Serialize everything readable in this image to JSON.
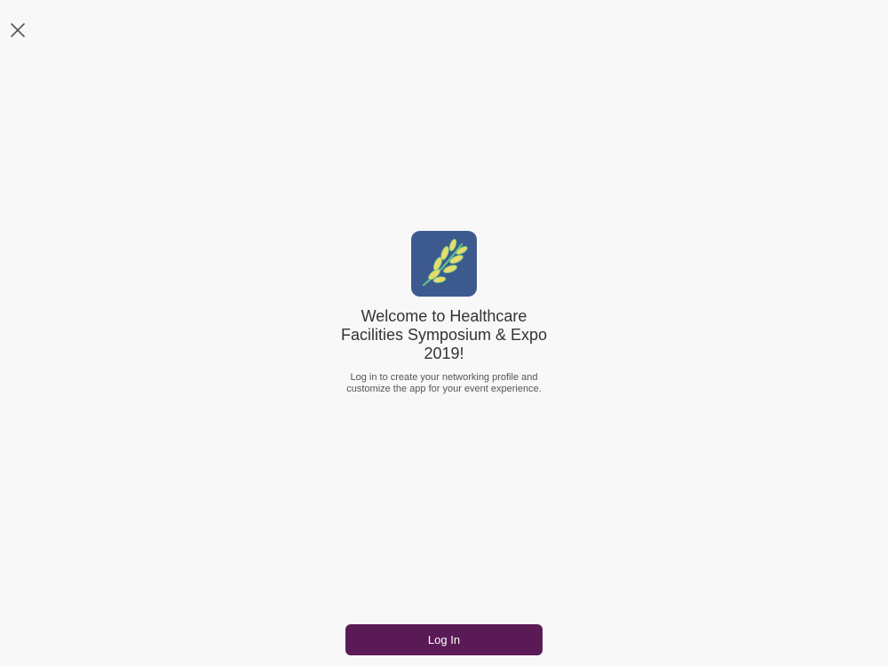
{
  "header": {
    "close_icon": "close-icon"
  },
  "welcome": {
    "app_icon": "leaf-branch-icon",
    "title": "Welcome to Healthcare Facilities Symposium & Expo 2019!",
    "subtitle": "Log in to create your networking profile and customize the app for your event experience."
  },
  "actions": {
    "login_label": "Log In"
  },
  "colors": {
    "background": "#f8f8f9",
    "icon_background": "#3d5a8f",
    "leaf": "#e6dc6e",
    "stem": "#5dbf8a",
    "button": "#5a1a55"
  }
}
